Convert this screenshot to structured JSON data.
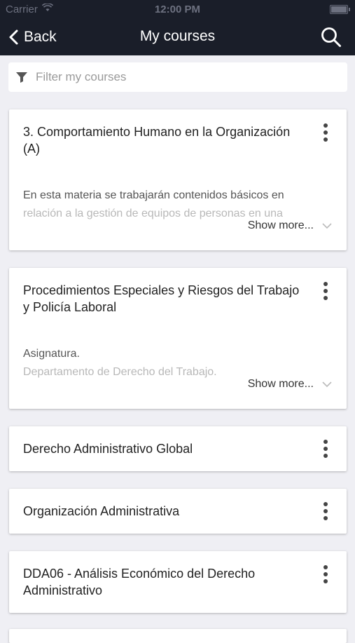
{
  "status_bar": {
    "carrier": "Carrier",
    "time": "12:00 PM"
  },
  "nav": {
    "back_label": "Back",
    "title": "My courses"
  },
  "filter": {
    "placeholder": "Filter my courses"
  },
  "courses": [
    {
      "title": "3. Comportamiento Humano en la Organización (A)",
      "desc_line1": "En esta materia se trabajarán contenidos básicos en",
      "desc_line2": "relación a la gestión de equipos de personas en una",
      "show_more": "Show more..."
    },
    {
      "title": "Procedimientos Especiales y Riesgos del Trabajo y Policía Laboral",
      "desc_line1": "Asignatura.",
      "desc_line2": "Departamento de Derecho del Trabajo.",
      "show_more": "Show more..."
    },
    {
      "title": "Derecho Administrativo Global"
    },
    {
      "title": "Organización Administrativa"
    },
    {
      "title": "DDA06 - Análisis Económico del Derecho Administrativo"
    }
  ],
  "colors": {
    "nav_bg": "#1a1e29",
    "page_bg": "#efeff4",
    "card_bg": "#ffffff"
  }
}
